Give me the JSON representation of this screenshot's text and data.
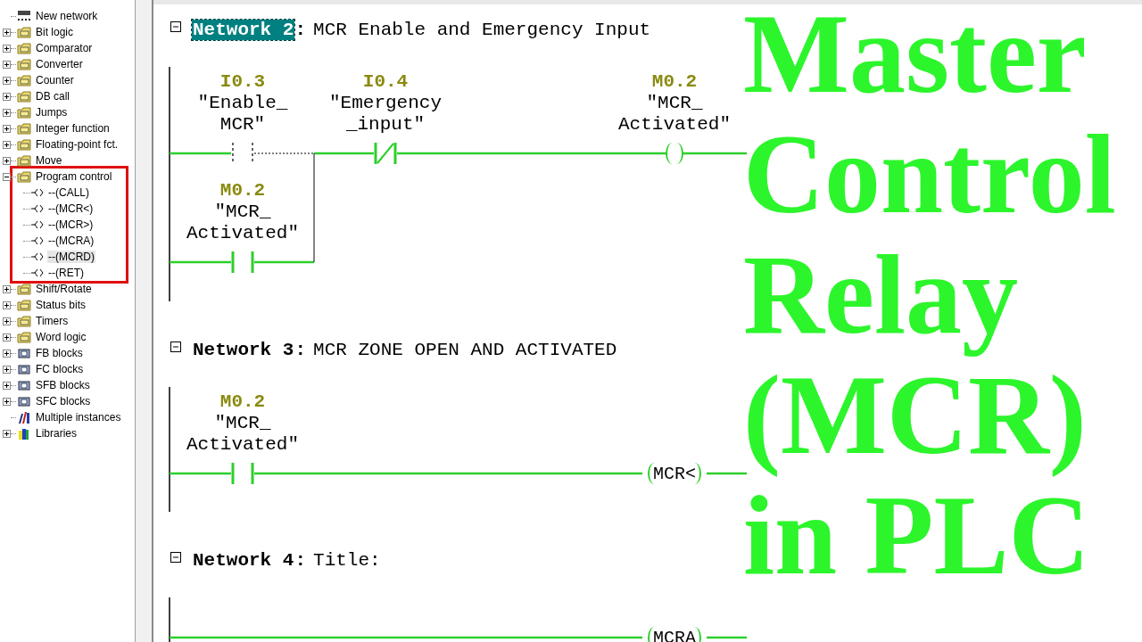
{
  "sidebar": {
    "items": [
      {
        "label": "New network",
        "kind": "network"
      },
      {
        "label": "Bit logic",
        "kind": "folder",
        "expanded": false
      },
      {
        "label": "Comparator",
        "kind": "folder",
        "expanded": false
      },
      {
        "label": "Converter",
        "kind": "folder",
        "expanded": false
      },
      {
        "label": "Counter",
        "kind": "folder",
        "expanded": false
      },
      {
        "label": "DB call",
        "kind": "folder",
        "expanded": false
      },
      {
        "label": "Jumps",
        "kind": "folder",
        "expanded": false
      },
      {
        "label": "Integer function",
        "kind": "folder",
        "expanded": false
      },
      {
        "label": "Floating-point fct.",
        "kind": "folder",
        "expanded": false
      },
      {
        "label": "Move",
        "kind": "folder",
        "expanded": false
      },
      {
        "label": "Program control",
        "kind": "folder",
        "expanded": true,
        "highlighted": true,
        "children": [
          {
            "label": "--(CALL)",
            "selected": false
          },
          {
            "label": "--(MCR<)",
            "selected": false
          },
          {
            "label": "--(MCR>)",
            "selected": false
          },
          {
            "label": "--(MCRA)",
            "selected": false
          },
          {
            "label": "--(MCRD)",
            "selected": true
          },
          {
            "label": "--(RET)",
            "selected": false
          }
        ]
      },
      {
        "label": "Shift/Rotate",
        "kind": "folder",
        "expanded": false
      },
      {
        "label": "Status bits",
        "kind": "folder",
        "expanded": false
      },
      {
        "label": "Timers",
        "kind": "folder",
        "expanded": false
      },
      {
        "label": "Word logic",
        "kind": "folder",
        "expanded": false
      },
      {
        "label": "FB blocks",
        "kind": "block",
        "expanded": false
      },
      {
        "label": "FC blocks",
        "kind": "block",
        "expanded": false
      },
      {
        "label": "SFB blocks",
        "kind": "block",
        "expanded": false
      },
      {
        "label": "SFC blocks",
        "kind": "block",
        "expanded": false
      },
      {
        "label": "Multiple instances",
        "kind": "instances"
      },
      {
        "label": "Libraries",
        "kind": "libraries",
        "expanded": false
      }
    ]
  },
  "networks": [
    {
      "label": "Network 2",
      "selected": true,
      "separator": ":",
      "title": "MCR Enable and Emergency Input",
      "rung": [
        {
          "kind": "no",
          "address": "I0.3",
          "symbol": [
            "\"Enable_",
            "MCR\""
          ],
          "energized": false
        },
        {
          "kind": "nc",
          "address": "I0.4",
          "symbol": [
            "\"Emergency",
            "_input\""
          ],
          "energized": true
        },
        {
          "kind": "coil",
          "address": "M0.2",
          "symbol": [
            "\"MCR_",
            "Activated\""
          ]
        }
      ],
      "branch": [
        {
          "kind": "no",
          "address": "M0.2",
          "symbol": [
            "\"MCR_",
            "Activated\""
          ],
          "energized": true
        }
      ]
    },
    {
      "label": "Network 3",
      "selected": false,
      "separator": ":",
      "title": "MCR ZONE OPEN AND ACTIVATED",
      "rung": [
        {
          "kind": "no",
          "address": "M0.2",
          "symbol": [
            "\"MCR_",
            "Activated\""
          ],
          "energized": true
        },
        {
          "kind": "coil",
          "text": "MCR<"
        }
      ]
    },
    {
      "label": "Network 4",
      "selected": false,
      "separator": ":",
      "title": "Title:",
      "rung": [
        {
          "kind": "coil",
          "text": "MCRA"
        }
      ]
    }
  ],
  "overlay_title": [
    "Master",
    "Control",
    "Relay",
    "(MCR)",
    "in PLC"
  ]
}
